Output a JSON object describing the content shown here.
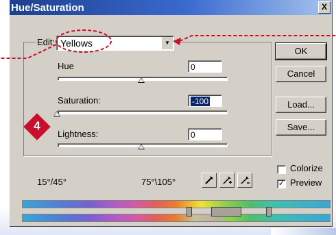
{
  "window": {
    "title": "Hue/Saturation",
    "close_label": "X"
  },
  "edit": {
    "label": "Edit:",
    "value": "Yellows"
  },
  "sliders": [
    {
      "label": "Hue",
      "value": "0",
      "level": 0.0
    },
    {
      "label": "Saturation:",
      "value": "-100",
      "level": -1.0
    },
    {
      "label": "Lightness:",
      "value": "0",
      "level": 0.0
    }
  ],
  "buttons": {
    "ok": "OK",
    "cancel": "Cancel",
    "load": "Load...",
    "save": "Save..."
  },
  "options": {
    "colorize": {
      "label": "Colorize",
      "checked": false
    },
    "preview": {
      "label": "Preview",
      "checked": true
    }
  },
  "ranges": {
    "left": "15°/45°",
    "right": "75°\\105°"
  },
  "annotation": {
    "step": "4",
    "color": "#c8102e"
  }
}
